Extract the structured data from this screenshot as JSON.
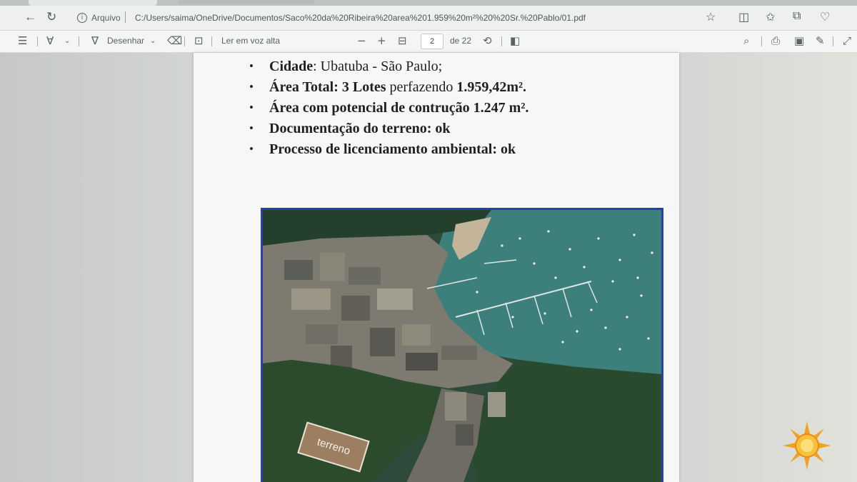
{
  "browser": {
    "address_label": "Arquivo",
    "url": "C:/Users/saima/OneDrive/Documentos/Saco%20da%20Ribeira%20area%201.959%20m²%20%20Sr.%20Pablo/01.pdf"
  },
  "pdf_toolbar": {
    "draw_label": "Desenhar",
    "read_aloud_label": "Ler em voz alta",
    "page_current": "2",
    "page_total": "de 22"
  },
  "document": {
    "bullets": [
      {
        "bold": "Cidade",
        "rest": ": Ubatuba - São Paulo;"
      },
      {
        "bold": "Área Total: 3 Lotes",
        "rest": " perfazendo ",
        "bold2": "1.959,42m²."
      },
      {
        "bold": "Área com potencial de contrução 1.247 m².",
        "rest": ""
      },
      {
        "bold": "Documentação do terreno: ok",
        "rest": ""
      },
      {
        "bold": "Processo de licenciamento ambiental:  ok",
        "rest": ""
      }
    ],
    "photo_label": "terreno"
  },
  "colors": {
    "photo_border": "#2a3fae",
    "label_bg": "#9c7f60"
  }
}
